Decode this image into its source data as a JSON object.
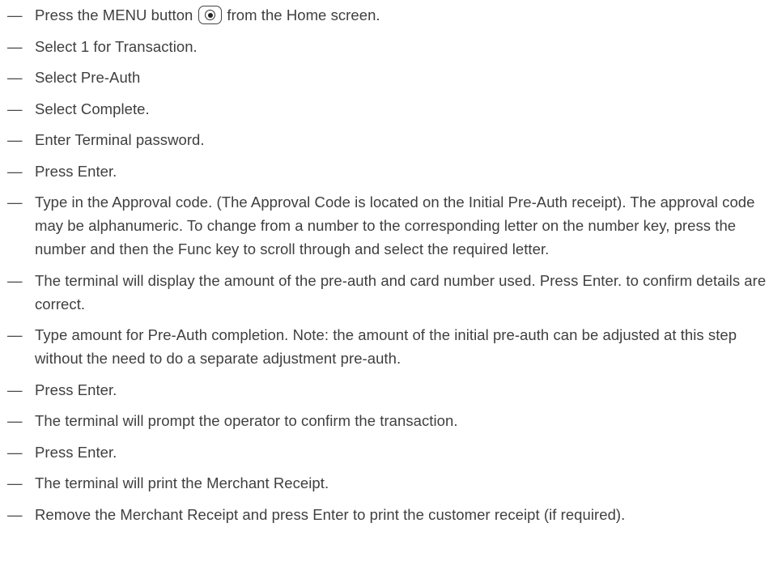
{
  "dash": "—",
  "steps": [
    {
      "before": "Press the MENU button",
      "icon": "menu-button-icon",
      "after": "from the Home screen."
    },
    {
      "text": "Select 1 for Transaction."
    },
    {
      "text": "Select Pre-Auth"
    },
    {
      "text": "Select Complete."
    },
    {
      "text": "Enter Terminal password."
    },
    {
      "text": "Press Enter."
    },
    {
      "text": "Type in the Approval code. (The Approval Code is located on the Initial Pre-Auth receipt). The approval code may be alphanumeric. To change from a number to the corresponding letter on the number key, press the number and then the Func key to scroll through and select the required letter."
    },
    {
      "text": "The terminal will display the amount of the pre-auth and card number used. Press Enter. to confirm details are correct."
    },
    {
      "text": "Type amount for Pre-Auth completion. Note: the amount of the initial pre-auth can be adjusted at this step without the need to do a separate adjustment pre-auth."
    },
    {
      "text": "Press Enter."
    },
    {
      "text": "The terminal will prompt the operator to confirm the transaction."
    },
    {
      "text": "Press Enter."
    },
    {
      "text": "The terminal will print the Merchant Receipt."
    },
    {
      "text": "Remove the Merchant Receipt and press Enter to print the customer receipt (if required)."
    }
  ]
}
